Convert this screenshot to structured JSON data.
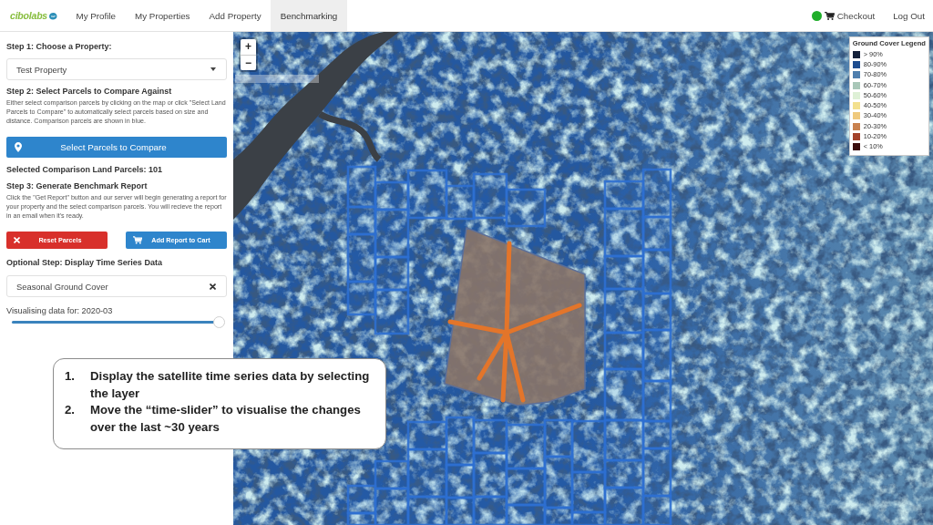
{
  "navbar": {
    "logo": "cibolabs",
    "tabs": [
      {
        "label": "My Profile",
        "selected": false
      },
      {
        "label": "My Properties",
        "selected": false
      },
      {
        "label": "Add Property",
        "selected": false
      },
      {
        "label": "Benchmarking",
        "selected": true
      }
    ],
    "checkout": "Checkout",
    "logout": "Log Out"
  },
  "sidebar": {
    "step1": {
      "heading": "Step 1: Choose a Property:",
      "property_select": {
        "value": "Test Property"
      }
    },
    "step2": {
      "heading": "Step 2: Select Parcels to Compare Against",
      "description": "Either select comparison parcels by clicking on the map or click \"Select Land Parcels to Compare\" to automatically select parcels based on size and distance. Comparison parcels are shown in blue.",
      "button": "Select Parcels to Compare",
      "selected_count": "Selected Comparison Land Parcels: 101"
    },
    "step3": {
      "heading": "Step 3: Generate Benchmark Report",
      "description": "Click the \"Get Report\" button and our server will begin generating a report for your property and the select comparison parcels. You will recieve the report in an email when it's ready.",
      "buttons": [
        {
          "label": "Reset Parcels",
          "kind": "danger"
        },
        {
          "label": "Add Report to Cart",
          "kind": "primary"
        }
      ]
    },
    "optional_step": {
      "heading": "Optional Step: Display Time Series Data",
      "layer_select": {
        "value": "Seasonal Ground Cover"
      },
      "date_label": "Visualising data for: 2020-03",
      "slider": {
        "level": 1
      }
    }
  },
  "map": {
    "zoom_in": "+",
    "zoom_out": "−",
    "legend": {
      "title": "Ground Cover Legend",
      "items": [
        {
          "label": "> 90%",
          "color": "#14213a"
        },
        {
          "label": "80-90%",
          "color": "#1e4d8f"
        },
        {
          "label": "70-80%",
          "color": "#4f7fae"
        },
        {
          "label": "60-70%",
          "color": "#a9c7b8"
        },
        {
          "label": "50-60%",
          "color": "#def0d6"
        },
        {
          "label": "40-50%",
          "color": "#f3e08e"
        },
        {
          "label": "30-40%",
          "color": "#efc97d"
        },
        {
          "label": "20-30%",
          "color": "#c9814f"
        },
        {
          "label": "10-20%",
          "color": "#a3422a"
        },
        {
          "label": "< 10%",
          "color": "#3b0d0d"
        }
      ]
    }
  },
  "callout": {
    "items": [
      {
        "number": "1.",
        "text": "Display the satellite time series data by selecting the layer"
      },
      {
        "number": "2.",
        "text": "Move the “time-slider” to visualise the changes over the last ~30 years"
      }
    ]
  }
}
